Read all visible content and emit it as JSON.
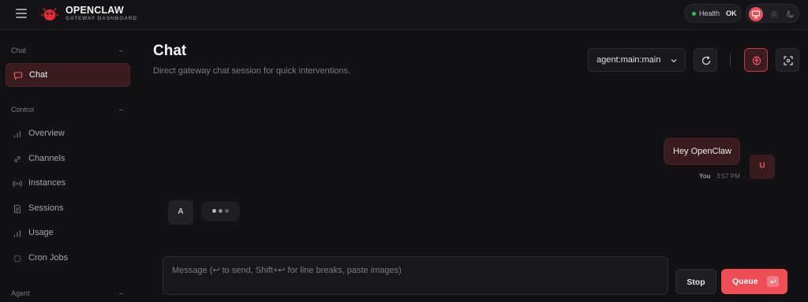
{
  "app": {
    "brand_title": "OPENCLAW",
    "brand_subtitle": "GATEWAY DASHBOARD",
    "health_label": "Health",
    "health_value": "OK",
    "health_color": "#22c55e",
    "accent_color": "#ef4e56"
  },
  "sidebar": {
    "sections": [
      {
        "title": "Chat",
        "items": [
          {
            "label": "Chat",
            "icon": "chat-bubble-icon",
            "active": true
          }
        ]
      },
      {
        "title": "Control",
        "items": [
          {
            "label": "Overview",
            "icon": "bar-chart-icon"
          },
          {
            "label": "Channels",
            "icon": "link-icon"
          },
          {
            "label": "Instances",
            "icon": "radio-icon"
          },
          {
            "label": "Sessions",
            "icon": "document-icon"
          },
          {
            "label": "Usage",
            "icon": "bar-chart-icon"
          },
          {
            "label": "Cron Jobs",
            "icon": "loader-icon"
          }
        ]
      },
      {
        "title": "Agent",
        "items": []
      }
    ]
  },
  "main": {
    "title": "Chat",
    "subtitle": "Direct gateway chat session for quick interventions.",
    "session_select_value": "agent:main:main"
  },
  "messages": [
    {
      "role": "user",
      "avatar": "U",
      "text": "Hey OpenClaw",
      "sender": "You",
      "time": "3:57 PM"
    },
    {
      "role": "assistant",
      "avatar": "A",
      "typing": true
    }
  ],
  "composer": {
    "placeholder": "Message (↩ to send, Shift+↩ for line breaks, paste images)",
    "stop_label": "Stop",
    "queue_label": "Queue"
  }
}
